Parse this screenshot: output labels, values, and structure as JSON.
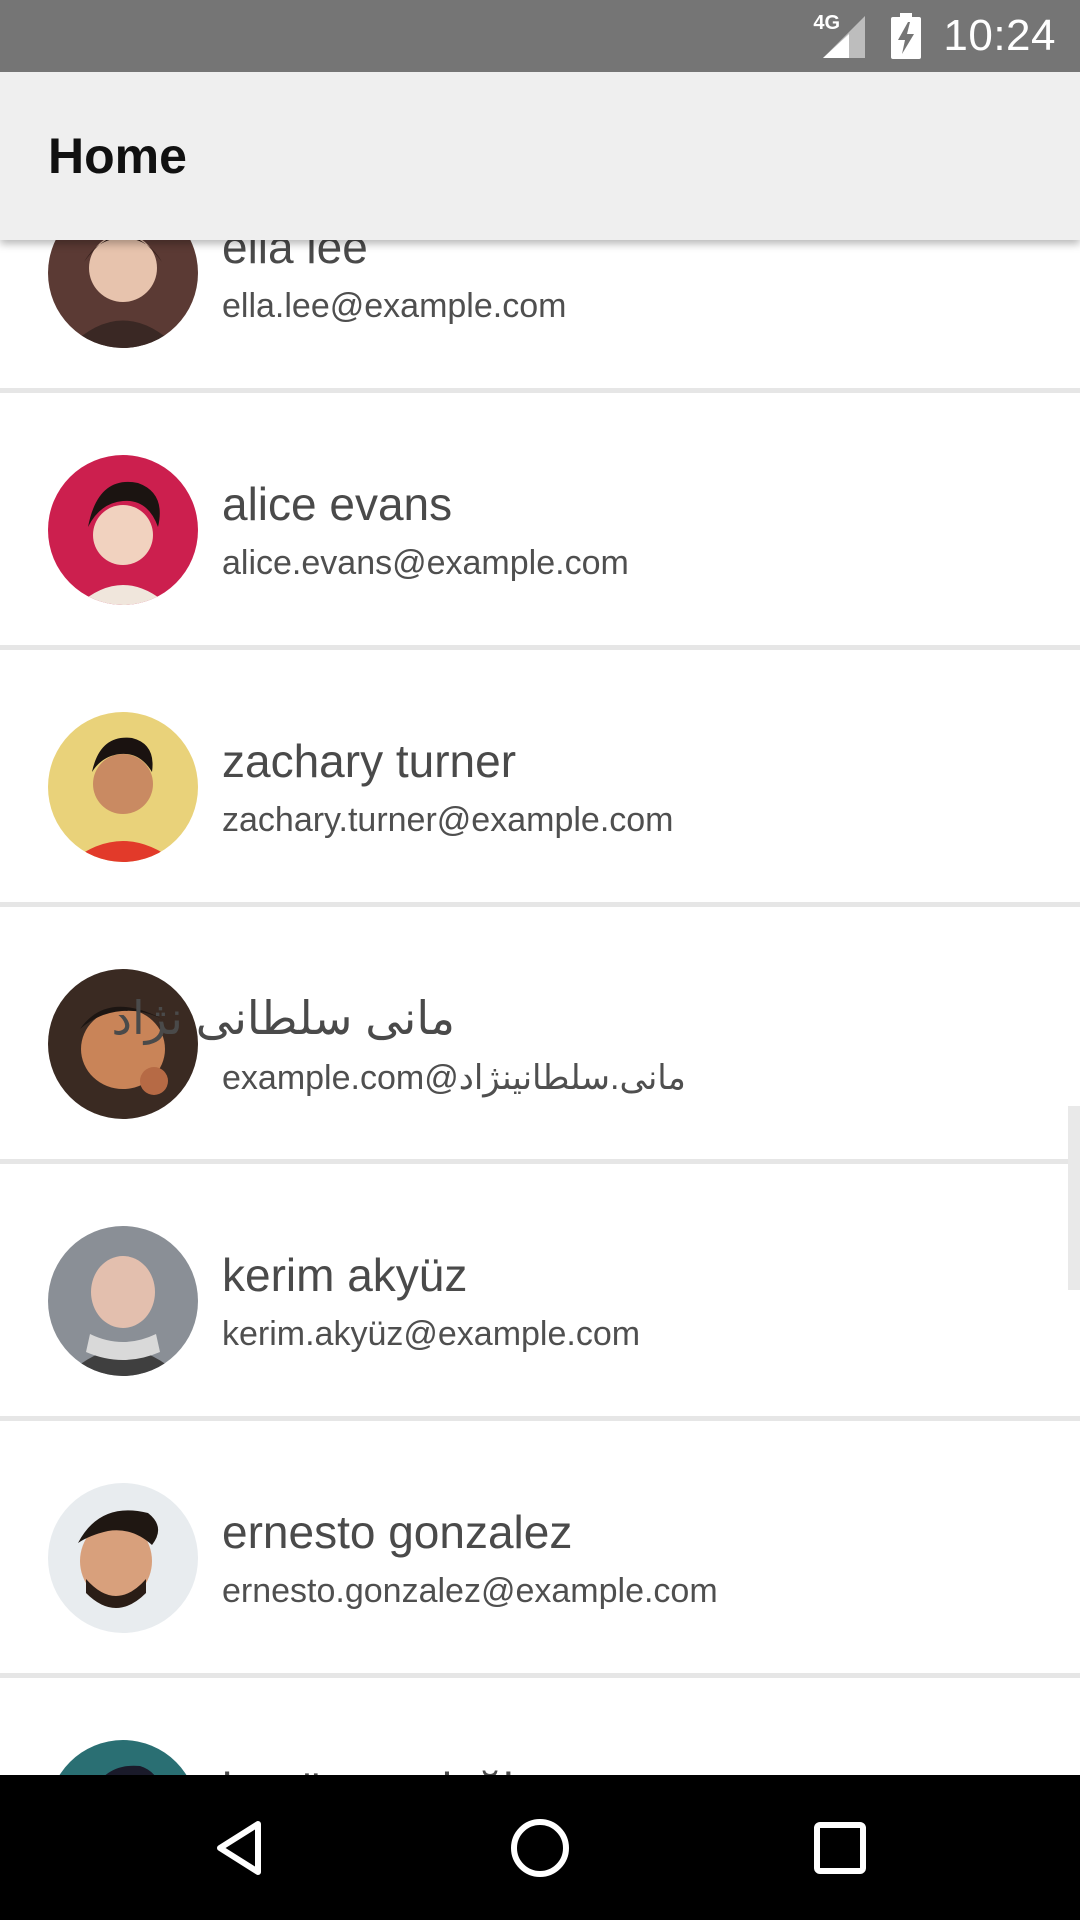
{
  "status_bar": {
    "network": "4G",
    "time": "10:24"
  },
  "app_bar": {
    "title": "Home"
  },
  "contacts": [
    {
      "name": "ella lee",
      "email": "ella.lee@example.com",
      "avatar_icon": "avatar-photo",
      "avatar_bg": "#5b3a34"
    },
    {
      "name": "alice evans",
      "email": "alice.evans@example.com",
      "avatar_icon": "avatar-photo",
      "avatar_bg": "#cc1f4e"
    },
    {
      "name": "zachary turner",
      "email": "zachary.turner@example.com",
      "avatar_icon": "avatar-photo",
      "avatar_bg": "#e9d27a"
    },
    {
      "name": "مانی سلطانی نژاد",
      "email": "example.com@مانی.سلطانینژاد",
      "avatar_icon": "avatar-photo",
      "avatar_bg": "#3a2a22"
    },
    {
      "name": "kerim akyüz",
      "email": "kerim.akyüz@example.com",
      "avatar_icon": "avatar-photo",
      "avatar_bg": "#8a8f96"
    },
    {
      "name": "ernesto gonzalez",
      "email": "ernesto.gonzalez@example.com",
      "avatar_icon": "avatar-photo",
      "avatar_bg": "#e8ecef"
    },
    {
      "name": "begüm oraloğlu",
      "email": "",
      "avatar_icon": "avatar-photo",
      "avatar_bg": "#2a6f73"
    }
  ],
  "colors": {
    "status_bar": "#757575",
    "app_bar": "#efefef",
    "divider": "#e6e6e6",
    "nav_bar": "#000000",
    "text": "#4a4a4a"
  },
  "nav_bar": {
    "icons": [
      "back-icon",
      "home-icon",
      "recents-icon"
    ]
  }
}
